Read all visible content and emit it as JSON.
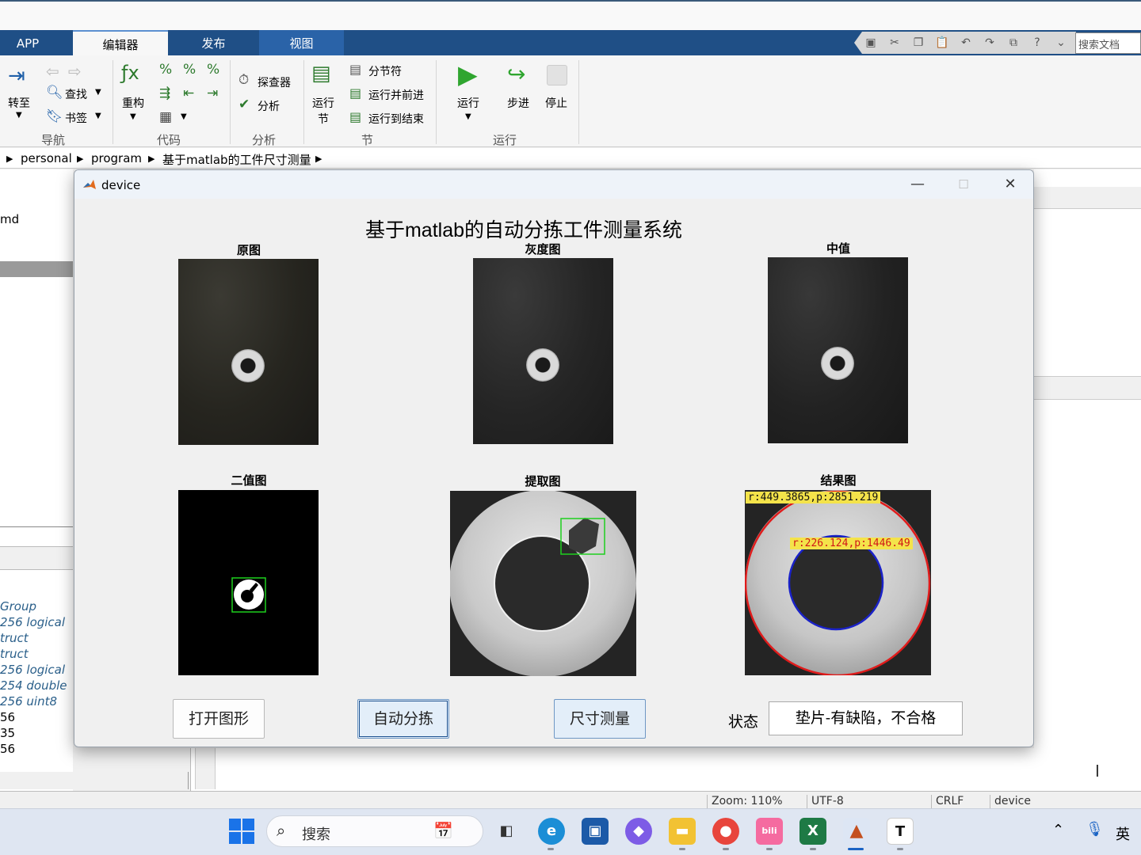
{
  "ribbon": {
    "tabs": [
      "APP",
      "编辑器",
      "发布",
      "视图"
    ],
    "search_placeholder": "搜索文档",
    "nav": {
      "goto": "转至",
      "find": "查找",
      "bookmark": "书签",
      "group": "导航"
    },
    "code": {
      "refactor": "重构",
      "group": "代码"
    },
    "analyze": {
      "inspector": "探查器",
      "analyze": "分析",
      "group": "分析"
    },
    "section": {
      "run_section_1": "运行",
      "run_section_2": "节",
      "section_break": "分节符",
      "run_advance": "运行并前进",
      "run_to_end": "运行到结束",
      "group": "节"
    },
    "run": {
      "run": "运行",
      "step": "步进",
      "stop": "停止",
      "group": "运行"
    }
  },
  "breadcrumb": [
    "personal",
    "program",
    "基于matlab的工件尺寸测量"
  ],
  "left_panel": {
    "cmd_fragment": "md",
    "vars_italic": [
      "Group",
      "256 logical",
      "truct",
      "truct",
      "256 logical",
      "254 double",
      "256 uint8"
    ],
    "vars_plain": [
      "56",
      "35",
      "56"
    ]
  },
  "statusbar": {
    "zoom": "Zoom: 110%",
    "encoding": "UTF-8",
    "eol": "CRLF",
    "file": "device"
  },
  "taskbar": {
    "search": "搜索",
    "ime": "英"
  },
  "device": {
    "window_title": "device",
    "heading": "基于matlab的自动分拣工件测量系统",
    "panels": {
      "original": "原图",
      "gray": "灰度图",
      "median": "中值",
      "binary": "二值图",
      "extract": "提取图",
      "result": "结果图"
    },
    "result_annotations": {
      "outer": "r:449.3865,p:2851.219",
      "inner": "r:226.124,p:1446.49"
    },
    "buttons": {
      "open": "打开图形",
      "sort": "自动分拣",
      "measure": "尺寸测量"
    },
    "status_label": "状态",
    "status_value": "垫片-有缺陷，不合格"
  }
}
